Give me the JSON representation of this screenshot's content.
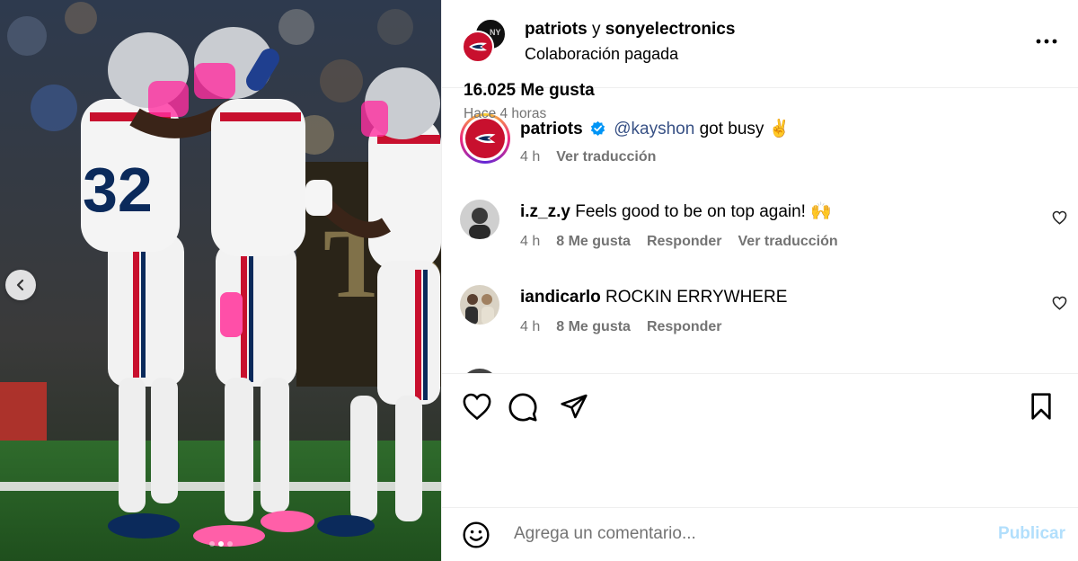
{
  "header": {
    "account1": "patriots",
    "conjunction": " y ",
    "account2": "sonyelectronics",
    "subtitle": "Colaboración pagada",
    "sony_avatar_text": "NY"
  },
  "caption": {
    "username": "patriots",
    "mention": "@kayshon",
    "text": " got busy ✌️",
    "time": "4 h",
    "translate": "Ver traducción"
  },
  "comments": [
    {
      "username": "i.z_z.y",
      "text": " Feels good to be on top again! 🙌",
      "time": "4 h",
      "likes": "8 Me gusta",
      "reply": "Responder",
      "translate": "Ver traducción"
    },
    {
      "username": "iandicarlo",
      "text": " ROCKIN ERRYWHERE",
      "time": "4 h",
      "likes": "8 Me gusta",
      "reply": "Responder"
    }
  ],
  "stats": {
    "likes": "16.025 Me gusta",
    "posted": "Hace 4 horas"
  },
  "composer": {
    "placeholder": "Agrega un comentario...",
    "publish": "Publicar"
  },
  "icons": [
    "chevron-left-icon",
    "more-icon",
    "verified-icon",
    "heart-icon",
    "comment-icon",
    "share-icon",
    "bookmark-icon",
    "emoji-icon"
  ],
  "colors": {
    "accent_blue": "#0095f6",
    "publish_disabled": "#b2dffc",
    "secondary_text": "#737373",
    "brand_red": "#c8102e"
  }
}
